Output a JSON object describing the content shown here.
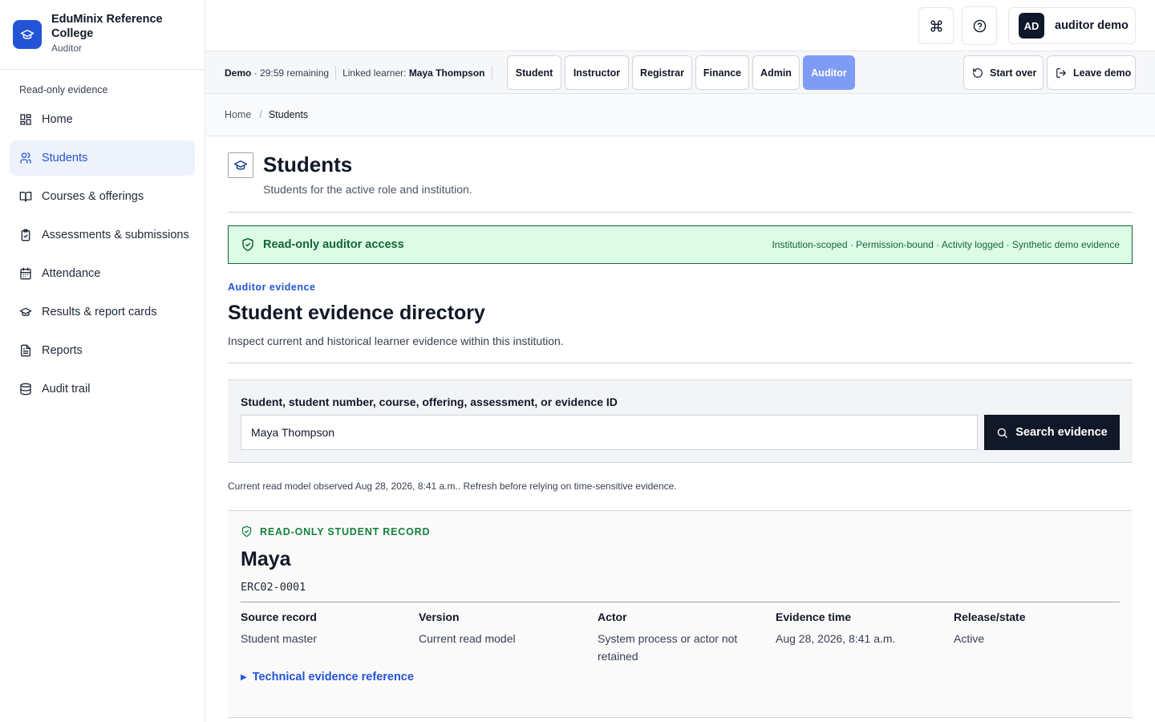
{
  "brand": {
    "name": "EduMinix Reference College",
    "role": "Auditor"
  },
  "sidebar": {
    "section_title": "Read-only evidence",
    "items": [
      {
        "label": "Home",
        "icon": "dashboard-icon"
      },
      {
        "label": "Students",
        "icon": "users-icon",
        "active": true
      },
      {
        "label": "Courses & offerings",
        "icon": "book-icon"
      },
      {
        "label": "Assessments & submissions",
        "icon": "clipboard-check-icon"
      },
      {
        "label": "Attendance",
        "icon": "calendar-icon"
      },
      {
        "label": "Results & report cards",
        "icon": "graduation-cap-icon"
      },
      {
        "label": "Reports",
        "icon": "file-text-icon"
      },
      {
        "label": "Audit trail",
        "icon": "database-icon"
      }
    ]
  },
  "topbar": {
    "avatar_initials": "AD",
    "user_name": "auditor demo"
  },
  "demobar": {
    "demo_label": "Demo",
    "time_remaining": "· 29:59 remaining",
    "linked_label": "Linked learner:",
    "linked_name": "Maya Thompson",
    "roles": [
      "Student",
      "Instructor",
      "Registrar",
      "Finance",
      "Admin",
      "Auditor"
    ],
    "active_role": "Auditor",
    "start_over": "Start over",
    "leave_demo": "Leave demo"
  },
  "breadcrumb": {
    "home": "Home",
    "current": "Students"
  },
  "page": {
    "title": "Students",
    "subtitle": "Students for the active role and institution."
  },
  "banner": {
    "title": "Read-only auditor access",
    "meta": "Institution-scoped · Permission-bound · Activity logged · Synthetic demo evidence"
  },
  "section": {
    "eyebrow": "Auditor evidence",
    "title": "Student evidence directory",
    "description": "Inspect current and historical learner evidence within this institution."
  },
  "search": {
    "label": "Student, student number, course, offering, assessment, or evidence ID",
    "value": "Maya Thompson",
    "button": "Search evidence"
  },
  "observed_note": "Current read model observed Aug 28, 2026, 8:41 a.m.. Refresh before relying on time-sensitive evidence.",
  "record": {
    "eyebrow": "READ-ONLY STUDENT RECORD",
    "name": "Maya",
    "student_id": "ERC02-0001",
    "fields": [
      {
        "label": "Source record",
        "value": "Student master"
      },
      {
        "label": "Version",
        "value": "Current read model"
      },
      {
        "label": "Actor",
        "value": "System process or actor not retained"
      },
      {
        "label": "Evidence time",
        "value": "Aug 28, 2026, 8:41 a.m."
      },
      {
        "label": "Release/state",
        "value": "Active"
      }
    ],
    "tech_link": "Technical evidence reference"
  },
  "colors": {
    "accent": "#2454d6",
    "success": "#166534",
    "success_bg": "#dcfce7",
    "dark": "#111827",
    "active_role": "#7f9cf5"
  }
}
